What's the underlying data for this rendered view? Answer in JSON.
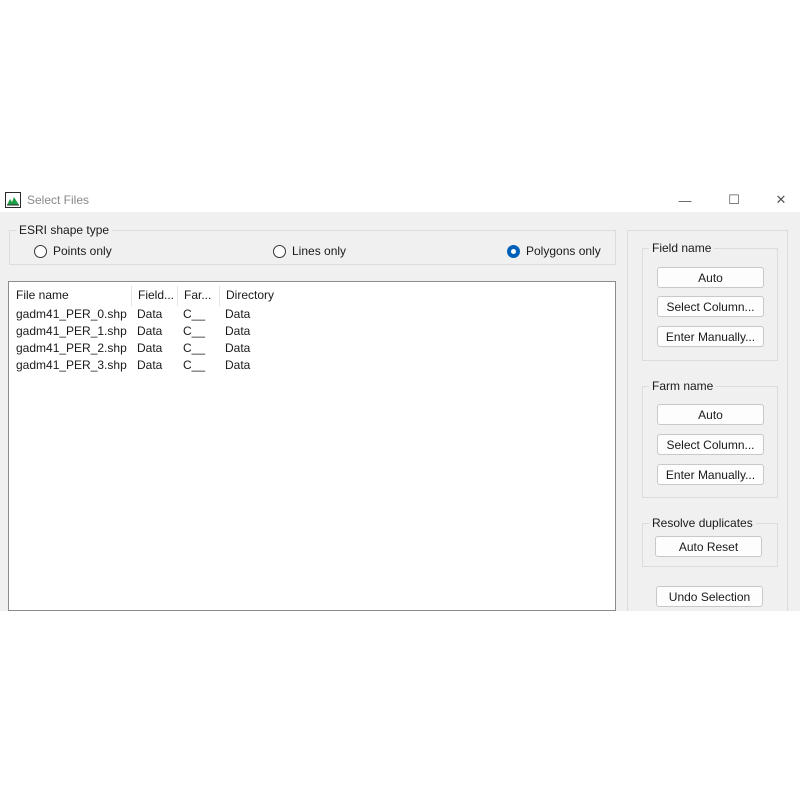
{
  "window": {
    "title": "Select Files",
    "controls": {
      "minimize": "—",
      "maximize": "☐",
      "close": "✕"
    }
  },
  "shape_type": {
    "title": "ESRI shape type",
    "options": [
      {
        "label": "Points only",
        "checked": false
      },
      {
        "label": "Lines only",
        "checked": false
      },
      {
        "label": "Polygons only",
        "checked": true
      }
    ]
  },
  "file_list": {
    "columns": [
      "File name",
      "Field...",
      "Far...",
      "Directory"
    ],
    "rows": [
      [
        "gadm41_PER_0.shp",
        "Data",
        "C__",
        "Data"
      ],
      [
        "gadm41_PER_1.shp",
        "Data",
        "C__",
        "Data"
      ],
      [
        "gadm41_PER_2.shp",
        "Data",
        "C__",
        "Data"
      ],
      [
        "gadm41_PER_3.shp",
        "Data",
        "C__",
        "Data"
      ]
    ]
  },
  "field_name": {
    "title": "Field name",
    "auto": "Auto",
    "select_column": "Select Column...",
    "enter_manually": "Enter Manually..."
  },
  "farm_name": {
    "title": "Farm name",
    "auto": "Auto",
    "select_column": "Select Column...",
    "enter_manually": "Enter Manually..."
  },
  "resolve_duplicates": {
    "title": "Resolve duplicates",
    "auto_reset": "Auto Reset"
  },
  "undo_selection": "Undo Selection",
  "colors": {
    "window_bg": "#f0f0f0",
    "titlebar_bg": "#ffffff",
    "accent": "#005fb8",
    "border": "#dcdcdc"
  }
}
